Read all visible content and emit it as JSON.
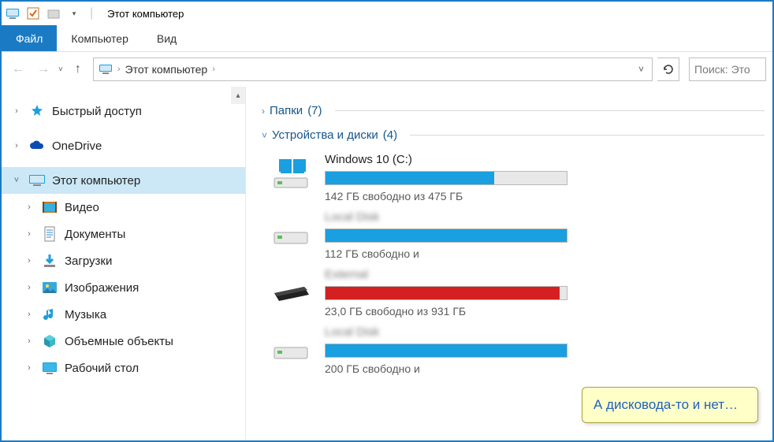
{
  "title": "Этот компьютер",
  "ribbon": {
    "file": "Файл",
    "computer": "Компьютер",
    "view": "Вид"
  },
  "address": {
    "crumb": "Этот компьютер"
  },
  "search": {
    "placeholder": "Поиск: Это"
  },
  "sidebar": {
    "quick": "Быстрый доступ",
    "onedrive": "OneDrive",
    "thispc": "Этот компьютер",
    "video": "Видео",
    "docs": "Документы",
    "downloads": "Загрузки",
    "pictures": "Изображения",
    "music": "Музыка",
    "objects3d": "Объемные объекты",
    "desktop": "Рабочий стол"
  },
  "groups": {
    "folders": {
      "name": "Папки",
      "count": "(7)"
    },
    "devices": {
      "name": "Устройства и диски",
      "count": "(4)"
    }
  },
  "drives": [
    {
      "name": "Windows 10 (C:)",
      "free": "142 ГБ свободно из 475 ГБ",
      "pct": 70,
      "color": "blue",
      "blur": false,
      "icon": "win"
    },
    {
      "name": "Local Disk",
      "free": "112 ГБ свободно и",
      "pct": 100,
      "color": "blue",
      "blur": true,
      "icon": "hdd"
    },
    {
      "name": "External",
      "free": "23,0 ГБ свободно из 931 ГБ",
      "pct": 97,
      "color": "red",
      "blur": true,
      "icon": "ext"
    },
    {
      "name": "Local Disk",
      "free": "200 ГБ свободно и",
      "pct": 100,
      "color": "blue",
      "blur": true,
      "icon": "hdd"
    }
  ],
  "callout": "А дисковода-то и нет…"
}
